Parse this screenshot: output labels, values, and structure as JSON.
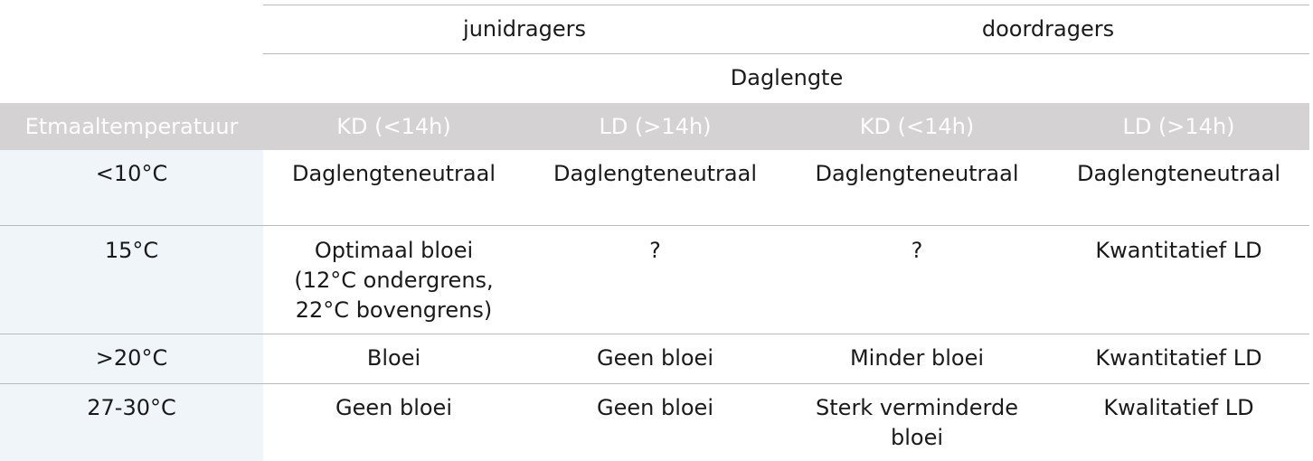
{
  "table": {
    "group_headers": {
      "left": "junidragers",
      "right": "doordragers"
    },
    "span_header": "Daglengte",
    "columns": [
      "Etmaaltemperatuur",
      "KD (<14h)",
      "LD (>14h)",
      "KD (<14h)",
      "LD (>14h)"
    ],
    "rows": [
      {
        "temp": "<10°C",
        "c1": "Daglengteneutraal",
        "c2": "Daglengteneutraal",
        "c3": "Daglengteneutraal",
        "c4": "Daglengteneutraal"
      },
      {
        "temp": "15°C",
        "c1": "Optimaal bloei",
        "c1_line2": "(12°C ondergrens,",
        "c1_line3": "22°C bovengrens)",
        "c2": "?",
        "c3": "?",
        "c4": "Kwantitatief LD"
      },
      {
        "temp": ">20°C",
        "c1": "Bloei",
        "c2": "Geen bloei",
        "c3": "Minder bloei",
        "c4": "Kwantitatief LD"
      },
      {
        "temp": "27-30°C",
        "c1": "Geen bloei",
        "c2": "Geen bloei",
        "c3": "Sterk verminderde",
        "c3_line2": "bloei",
        "c4": "Kwalitatief LD"
      }
    ],
    "colors": {
      "header_band": "#d4d2d3",
      "header_text": "#ffffff",
      "first_column": "#f0f5fa",
      "rule": "#b9b9b9",
      "text": "#1a1a1a"
    }
  }
}
